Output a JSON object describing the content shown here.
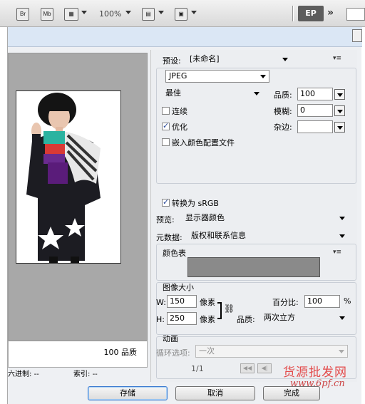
{
  "appbar": {
    "br_label": "Br",
    "mb_label": "Mb",
    "zoom": "100%",
    "ep_label": "EP",
    "more_label": "»"
  },
  "preview": {
    "quality_readout": "100 品质",
    "status_hex_label": "六进制:",
    "status_hex_value": "--",
    "status_index_label": "索引:",
    "status_index_value": "--"
  },
  "settings": {
    "preset_label": "预设:",
    "preset_value": "[未命名]",
    "format_value": "JPEG",
    "quality_level": "最佳",
    "quality_label": "品质:",
    "quality_value": "100",
    "progressive_label": "连续",
    "progressive_checked": false,
    "blur_label": "模糊:",
    "blur_value": "0",
    "optimized_label": "优化",
    "optimized_checked": true,
    "matte_label": "杂边:",
    "matte_value": "",
    "embed_profile_label": "嵌入颜色配置文件",
    "embed_profile_checked": false,
    "convert_srgb_label": "转换为 sRGB",
    "convert_srgb_checked": true,
    "preview_label": "预览:",
    "preview_value": "显示器颜色",
    "metadata_label": "元数据:",
    "metadata_value": "版权和联系信息",
    "color_table_label": "颜色表",
    "image_size_label": "图像大小",
    "width_label": "W:",
    "width_value": "150",
    "width_unit": "像素",
    "height_label": "H:",
    "height_value": "250",
    "height_unit": "像素",
    "percent_label": "百分比:",
    "percent_value": "100",
    "percent_unit": "%",
    "resample_label": "品质:",
    "resample_value": "两次立方",
    "animation_label": "动画",
    "loop_label": "循环选项:",
    "loop_value": "一次",
    "frame_counter": "1/1",
    "swatch_color": "#8a8a8a"
  },
  "buttons": {
    "save": "存储",
    "cancel": "取消",
    "done": "完成"
  },
  "watermark": {
    "text": "货源批发网",
    "url": "www.6pf.cn"
  }
}
